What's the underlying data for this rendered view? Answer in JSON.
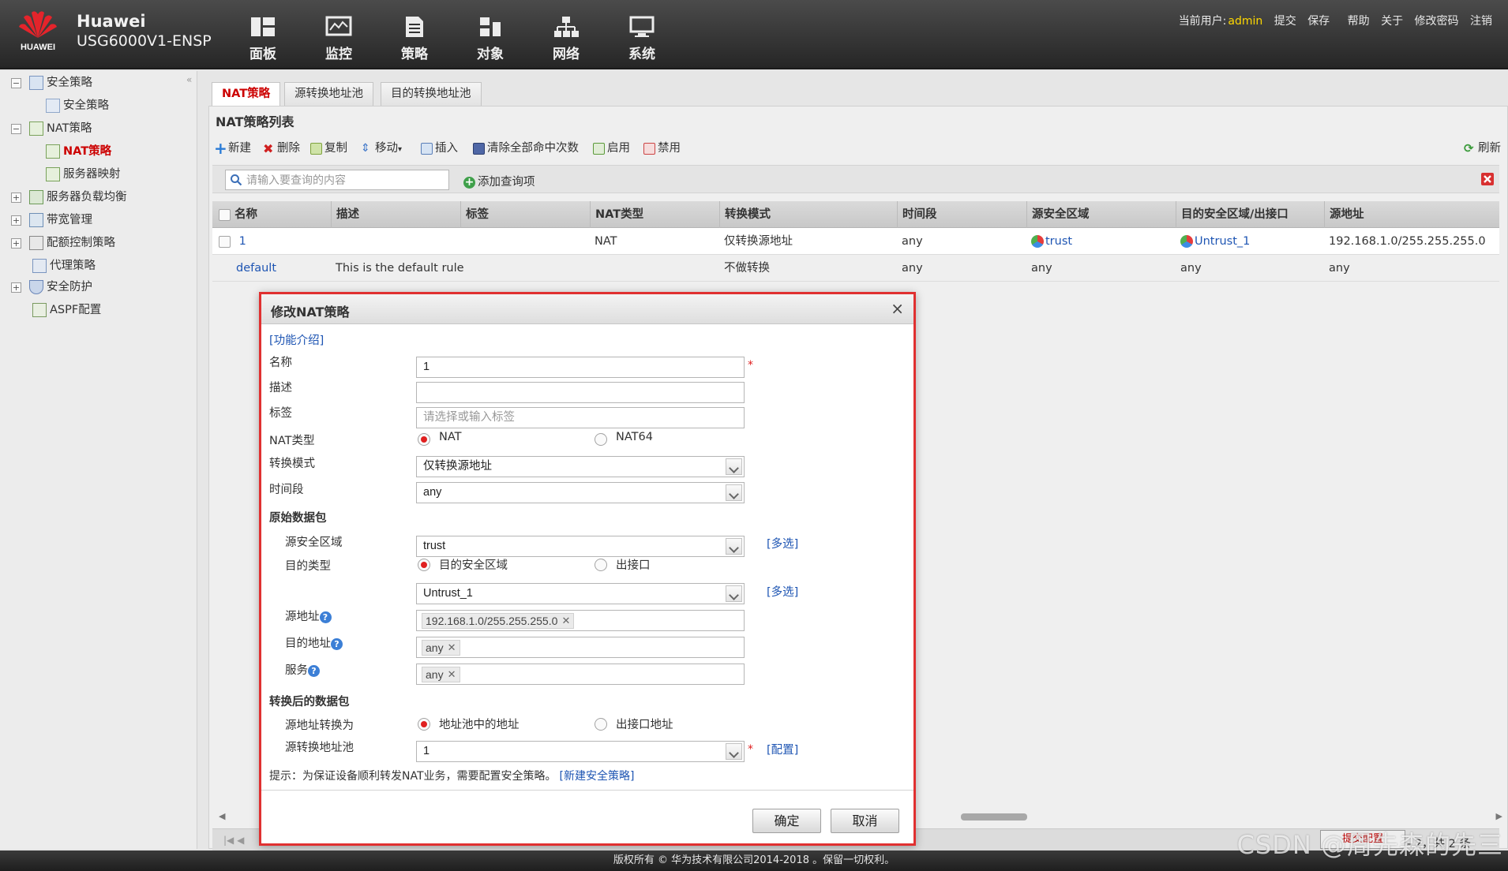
{
  "header": {
    "brand_line1": "Huawei",
    "brand_line2": "USG6000V1-ENSP",
    "logo_text": "HUAWEI",
    "nav": [
      "面板",
      "监控",
      "策略",
      "对象",
      "网络",
      "系统"
    ],
    "user_label": "当前用户:",
    "user_name": "admin",
    "links": [
      "提交",
      "保存",
      "帮助",
      "关于",
      "修改密码",
      "注销"
    ]
  },
  "sidebar": {
    "items": [
      {
        "label": "安全策略",
        "exp": "−"
      },
      {
        "label": "安全策略"
      },
      {
        "label": "NAT策略",
        "exp": "−"
      },
      {
        "label": "NAT策略"
      },
      {
        "label": "服务器映射"
      },
      {
        "label": "服务器负载均衡",
        "exp": "+"
      },
      {
        "label": "带宽管理",
        "exp": "+"
      },
      {
        "label": "配额控制策略",
        "exp": "+"
      },
      {
        "label": "代理策略"
      },
      {
        "label": "安全防护",
        "exp": "+"
      },
      {
        "label": "ASPF配置"
      }
    ]
  },
  "tabs": [
    "NAT策略",
    "源转换地址池",
    "目的转换地址池"
  ],
  "panel": {
    "title": "NAT策略列表",
    "toolbar": [
      "新建",
      "删除",
      "复制",
      "移动",
      "插入",
      "清除全部命中次数",
      "启用",
      "禁用"
    ],
    "refresh": "刷新",
    "search_placeholder": "请输入要查询的内容",
    "add_query": "添加查询项"
  },
  "table": {
    "columns": [
      "名称",
      "描述",
      "标签",
      "NAT类型",
      "转换模式",
      "时间段",
      "源安全区域",
      "目的安全区域/出接口",
      "源地址"
    ],
    "rows": [
      [
        "1",
        "",
        "",
        "NAT",
        "仅转换源地址",
        "any",
        "trust",
        "Untrust_1",
        "192.168.1.0/255.255.255.0"
      ],
      [
        "default",
        "This is the default rule",
        "",
        "",
        "不做转换",
        "any",
        "any",
        "any",
        "any"
      ]
    ]
  },
  "pager": {
    "info": "显示 1 - 2，共 2 条"
  },
  "dialog": {
    "title": "修改NAT策略",
    "intro": "[功能介绍]",
    "labels": {
      "name": "名称",
      "desc": "描述",
      "tag": "标签",
      "nat_type": "NAT类型",
      "mode": "转换模式",
      "time": "时间段",
      "orig_pkt": "原始数据包",
      "src_zone": "源安全区域",
      "dst_type": "目的类型",
      "src_addr": "源地址",
      "dst_addr": "目的地址",
      "service": "服务",
      "trans_pkt": "转换后的数据包",
      "src_trans": "源地址转换为",
      "pool": "源转换地址池"
    },
    "values": {
      "name": "1",
      "desc": "",
      "tag_placeholder": "请选择或输入标签",
      "nat_opt1": "NAT",
      "nat_opt2": "NAT64",
      "mode": "仅转换源地址",
      "time": "any",
      "src_zone": "trust",
      "dst_opt1": "目的安全区域",
      "dst_opt2": "出接口",
      "dst_zone": "Untrust_1",
      "src_addr_chip": "192.168.1.0/255.255.255.0",
      "dst_addr_chip": "any",
      "service_chip": "any",
      "trans_opt1": "地址池中的地址",
      "trans_opt2": "出接口地址",
      "pool": "1"
    },
    "multi_select": "[多选]",
    "config_link": "[配置]",
    "tip_text": "提示：为保证设备顺利转发NAT业务，需要配置安全策略。",
    "tip_link": "[新建安全策略]",
    "ok": "确定",
    "cancel": "取消"
  },
  "footer": {
    "copyright": "版权所有 © 华为技术有限公司2014-2018 。保留一切权利。"
  },
  "watermark": "CSDN @周先森的先三",
  "commit_button": "提交配置"
}
